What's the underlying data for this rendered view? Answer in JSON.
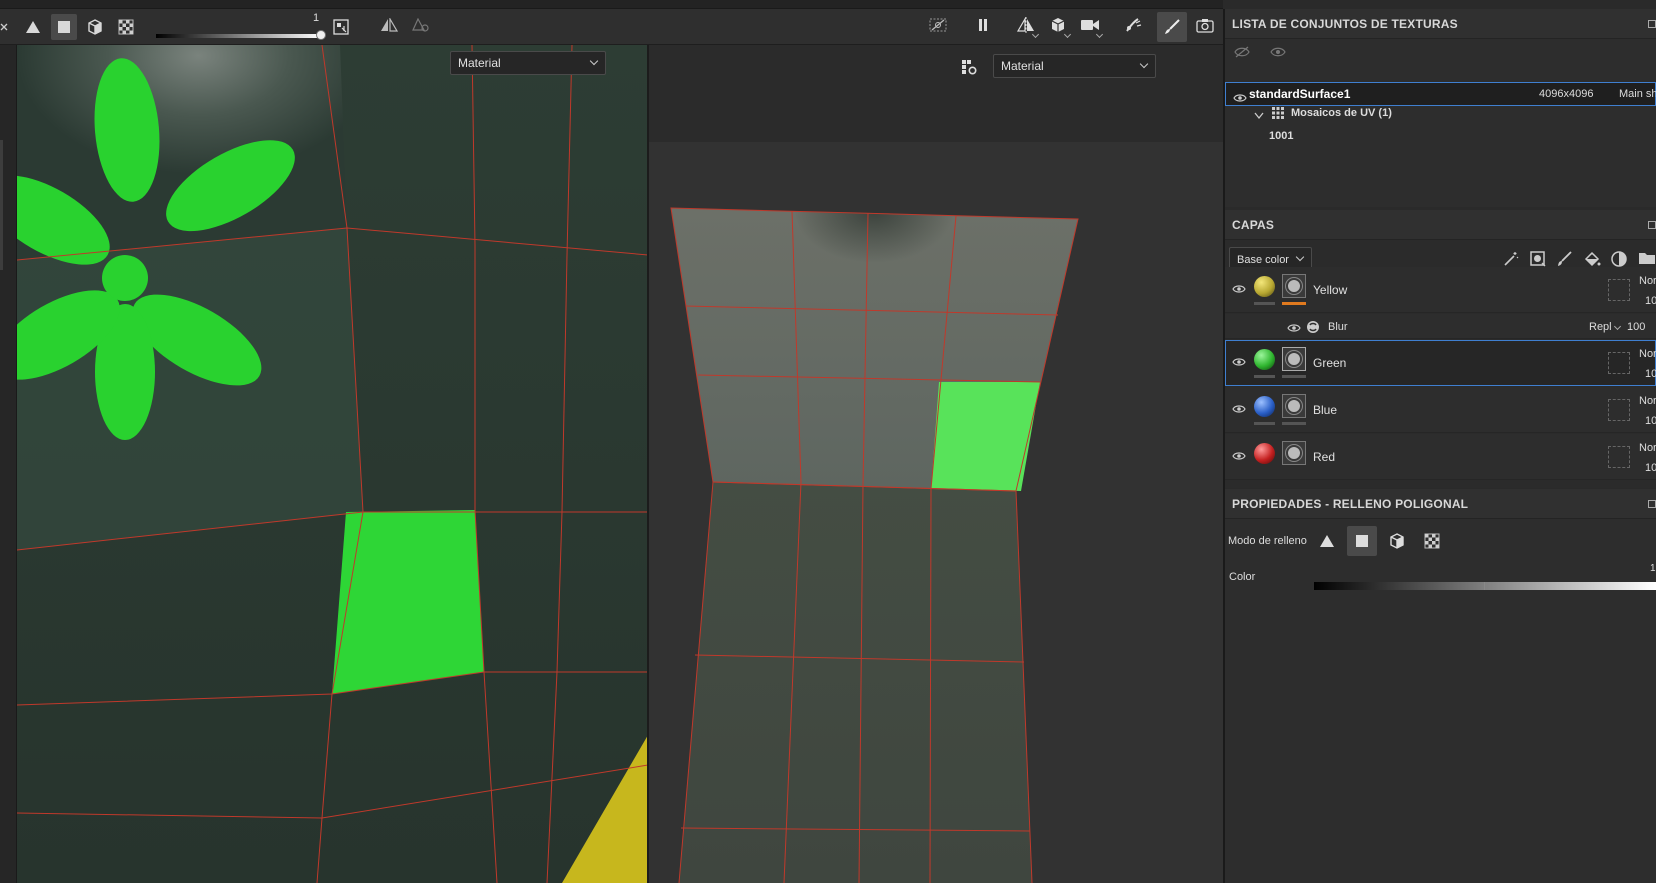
{
  "viewport_2d": {
    "dropdown_value": "Material"
  },
  "viewport_3d": {
    "dropdown_value": "Material"
  },
  "toolbar": {
    "slider_value": "1",
    "left_tools": [
      "triangle-fill-icon",
      "square-fill-icon",
      "cube-fill-icon",
      "checker-fill-icon"
    ],
    "right_tools": [
      "hide-uv-icon",
      "pause-icon",
      "mirror-icon",
      "cube-view-icon",
      "camera-view-icon",
      "smudge-icon",
      "brush-icon",
      "screenshot-icon"
    ]
  },
  "texture_sets": {
    "title": "LISTA DE CONJUNTOS DE TEXTURAS",
    "set": {
      "name": "standardSurface1",
      "resolution": "4096x4096",
      "shader": "Main sh"
    },
    "uv_group": "Mosaicos de UV (1)",
    "uv_tile": "1001"
  },
  "layers": {
    "title": "CAPAS",
    "channel": "Base color",
    "items": [
      {
        "name": "Yellow",
        "blend": "Nor",
        "opacity": "10",
        "ball_color": "#b8a832",
        "bar_color": "#e07a1f"
      },
      {
        "name": "Green",
        "blend": "Nor",
        "opacity": "10",
        "ball_color": "#2fb52f",
        "bar_color": "#555555"
      },
      {
        "name": "Blue",
        "blend": "Nor",
        "opacity": "10",
        "ball_color": "#2a5fc7",
        "bar_color": "#555555"
      },
      {
        "name": "Red",
        "blend": "Nor",
        "opacity": "10",
        "ball_color": "#c42020",
        "bar_color": "#555555"
      }
    ],
    "effect": {
      "name": "Blur",
      "blend": "Repl",
      "opacity": "100"
    }
  },
  "properties": {
    "title": "PROPIEDADES - RELLENO POLIGONAL",
    "fill_mode_label": "Modo de relleno",
    "color_label": "Color",
    "color_value": "1"
  },
  "colors": {
    "accent": "#3f7fd0",
    "fill_green": "#2ed636",
    "uv_line": "#c0392b"
  }
}
